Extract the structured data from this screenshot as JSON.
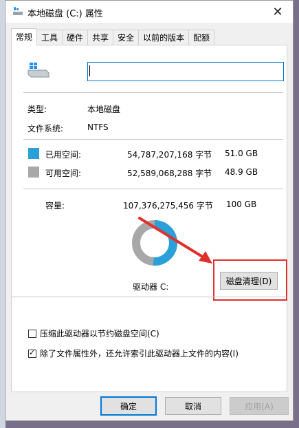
{
  "window": {
    "title": "本地磁盘 (C:) 属性",
    "close_glyph": "✕"
  },
  "tabs": [
    {
      "label": "常规",
      "active": true
    },
    {
      "label": "工具"
    },
    {
      "label": "硬件"
    },
    {
      "label": "共享"
    },
    {
      "label": "安全"
    },
    {
      "label": "以前的版本"
    },
    {
      "label": "配额"
    }
  ],
  "general": {
    "volume_name_value": "",
    "type_label": "类型:",
    "type_value": "本地磁盘",
    "fs_label": "文件系统:",
    "fs_value": "NTFS",
    "used": {
      "label": "已用空间:",
      "bytes": "54,787,207,168 字节",
      "size": "51.0 GB",
      "color": "#2a9fd8"
    },
    "free": {
      "label": "可用空间:",
      "bytes": "52,589,068,288 字节",
      "size": "48.9 GB",
      "color": "#a8a8a8"
    },
    "capacity": {
      "label": "容量:",
      "bytes": "107,376,275,456 字节",
      "size": "100 GB"
    },
    "used_fraction": 0.51,
    "drive_label": "驱动器 C:",
    "cleanup_button": "磁盘清理(D)",
    "highlight_color": "#e0302b"
  },
  "options": {
    "compress_label": "压缩此驱动器以节约磁盘空间(C)",
    "compress_checked": false,
    "index_label": "除了文件属性外，还允许索引此驱动器上文件的内容(I)",
    "index_checked": true
  },
  "buttons": {
    "ok": "确定",
    "cancel": "取消",
    "apply": "应用(A)"
  }
}
